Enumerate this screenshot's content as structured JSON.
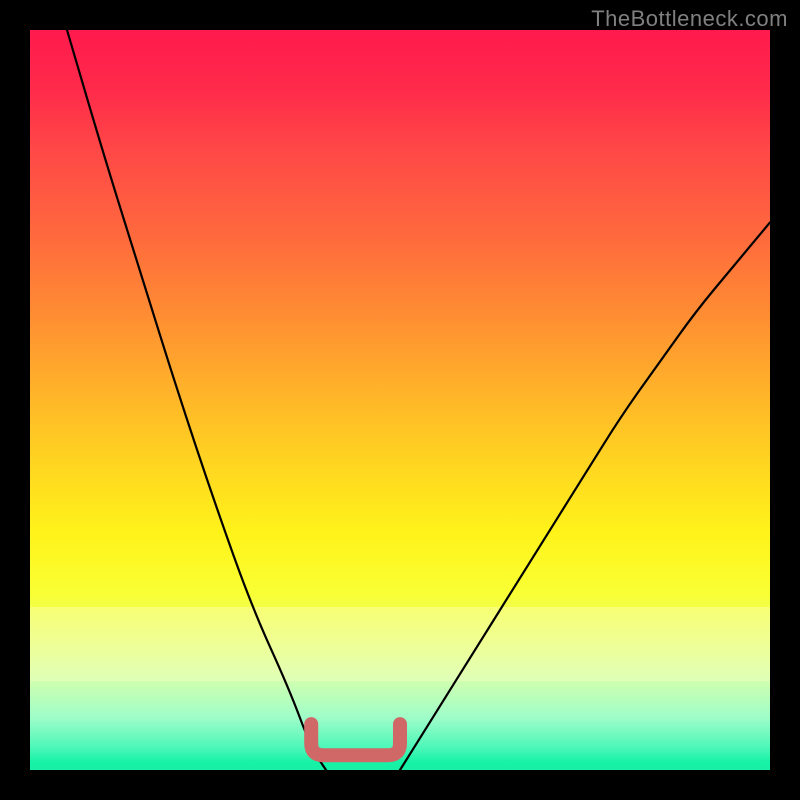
{
  "watermark": {
    "text": "TheBottleneck.com"
  },
  "chart_data": {
    "type": "line",
    "title": "",
    "xlabel": "",
    "ylabel": "",
    "xlim": [
      0,
      100
    ],
    "ylim": [
      0,
      100
    ],
    "grid": false,
    "series": [
      {
        "name": "left-branch",
        "x": [
          5,
          10,
          15,
          20,
          25,
          30,
          35,
          38,
          40
        ],
        "values": [
          100,
          83,
          67,
          51,
          36,
          22,
          11,
          3,
          0
        ],
        "color": "#000000"
      },
      {
        "name": "right-branch",
        "x": [
          50,
          55,
          60,
          65,
          70,
          75,
          80,
          85,
          90,
          95,
          100
        ],
        "values": [
          0,
          8,
          16,
          24,
          32,
          40,
          48,
          55,
          62,
          68,
          74
        ],
        "color": "#000000"
      }
    ],
    "bracket": {
      "x_start": 38,
      "x_end": 50,
      "y": 2,
      "color": "#d06868"
    },
    "highlight_band": {
      "y_start": 12,
      "y_end": 22,
      "color": "#ffffc8",
      "opacity": 0.35
    },
    "background_gradient": {
      "stops": [
        {
          "pos": 0,
          "color": "#ff1a4d"
        },
        {
          "pos": 28,
          "color": "#ff6a3d"
        },
        {
          "pos": 58,
          "color": "#ffd321"
        },
        {
          "pos": 76,
          "color": "#f9ff33"
        },
        {
          "pos": 93,
          "color": "#9efdc9"
        },
        {
          "pos": 100,
          "color": "#19f0a5"
        }
      ]
    }
  }
}
